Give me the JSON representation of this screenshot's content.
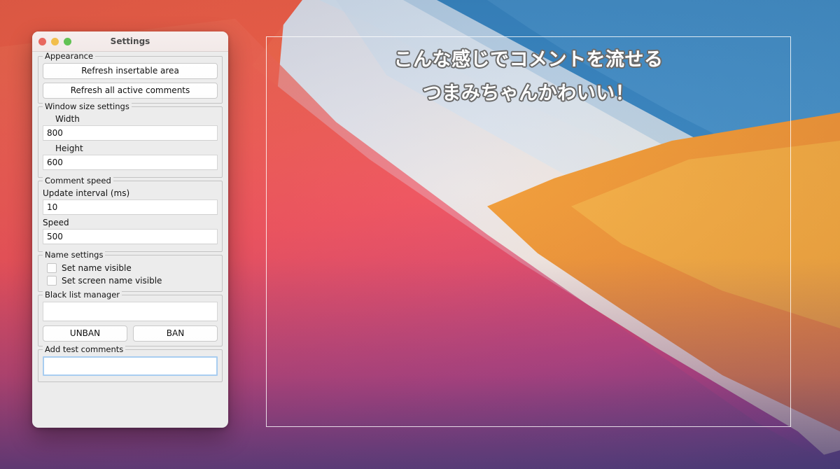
{
  "desktop": {
    "wallpaper_name": "big-sur-gradient",
    "colors": {
      "sky_blue": "#2f7fbe",
      "pale_band": "#dfe8f3",
      "orange": "#f0962f",
      "red": "#ee4a5f",
      "purple": "#56407f"
    }
  },
  "overlay": {
    "border_color": "#ffffff",
    "comments": [
      "こんな感じでコメントを流せる",
      "つまみちゃんかわいい！"
    ]
  },
  "settings_window": {
    "title": "Settings",
    "traffic_lights": [
      {
        "name": "close",
        "color": "#e8685f"
      },
      {
        "name": "minimize",
        "color": "#f2be4c"
      },
      {
        "name": "zoom",
        "color": "#62c254"
      }
    ],
    "groups": {
      "appearance": {
        "legend": "Appearance",
        "buttons": [
          "Refresh insertable area",
          "Refresh all active comments"
        ]
      },
      "window_size": {
        "legend": "Window size settings",
        "fields": [
          {
            "label": "Width",
            "value": "800",
            "placeholder": ""
          },
          {
            "label": "Height",
            "value": "600",
            "placeholder": ""
          }
        ]
      },
      "comment_speed": {
        "legend": "Comment speed",
        "fields": [
          {
            "label": "Update interval (ms)",
            "value": "10",
            "placeholder": ""
          },
          {
            "label": "Speed",
            "value": "500",
            "placeholder": ""
          }
        ]
      },
      "name_settings": {
        "legend": "Name settings",
        "checkboxes": [
          {
            "label": "Set name visible",
            "checked": false
          },
          {
            "label": "Set screen name visible",
            "checked": false
          }
        ]
      },
      "black_list": {
        "legend": "Black list manager",
        "input": {
          "value": "",
          "placeholder": ""
        },
        "buttons": [
          "UNBAN",
          "BAN"
        ]
      },
      "add_test_comments": {
        "legend": "Add test comments",
        "input": {
          "value": "",
          "placeholder": "",
          "focused": true
        }
      }
    }
  }
}
